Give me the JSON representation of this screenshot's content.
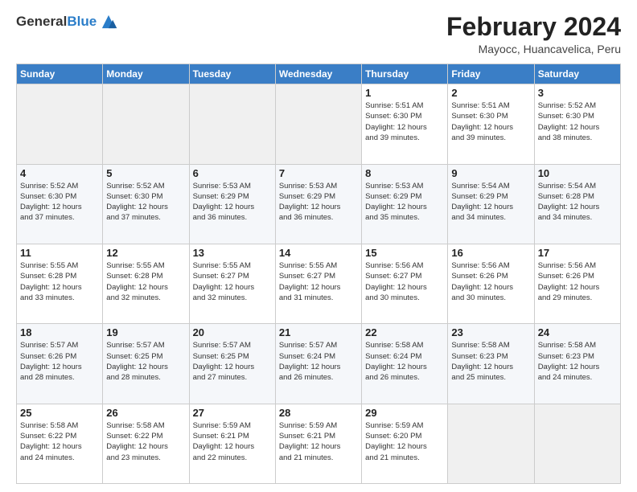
{
  "logo": {
    "general": "General",
    "blue": "Blue"
  },
  "title": "February 2024",
  "location": "Mayocc, Huancavelica, Peru",
  "days_header": [
    "Sunday",
    "Monday",
    "Tuesday",
    "Wednesday",
    "Thursday",
    "Friday",
    "Saturday"
  ],
  "weeks": [
    [
      {
        "day": "",
        "info": ""
      },
      {
        "day": "",
        "info": ""
      },
      {
        "day": "",
        "info": ""
      },
      {
        "day": "",
        "info": ""
      },
      {
        "day": "1",
        "info": "Sunrise: 5:51 AM\nSunset: 6:30 PM\nDaylight: 12 hours\nand 39 minutes."
      },
      {
        "day": "2",
        "info": "Sunrise: 5:51 AM\nSunset: 6:30 PM\nDaylight: 12 hours\nand 39 minutes."
      },
      {
        "day": "3",
        "info": "Sunrise: 5:52 AM\nSunset: 6:30 PM\nDaylight: 12 hours\nand 38 minutes."
      }
    ],
    [
      {
        "day": "4",
        "info": "Sunrise: 5:52 AM\nSunset: 6:30 PM\nDaylight: 12 hours\nand 37 minutes."
      },
      {
        "day": "5",
        "info": "Sunrise: 5:52 AM\nSunset: 6:30 PM\nDaylight: 12 hours\nand 37 minutes."
      },
      {
        "day": "6",
        "info": "Sunrise: 5:53 AM\nSunset: 6:29 PM\nDaylight: 12 hours\nand 36 minutes."
      },
      {
        "day": "7",
        "info": "Sunrise: 5:53 AM\nSunset: 6:29 PM\nDaylight: 12 hours\nand 36 minutes."
      },
      {
        "day": "8",
        "info": "Sunrise: 5:53 AM\nSunset: 6:29 PM\nDaylight: 12 hours\nand 35 minutes."
      },
      {
        "day": "9",
        "info": "Sunrise: 5:54 AM\nSunset: 6:29 PM\nDaylight: 12 hours\nand 34 minutes."
      },
      {
        "day": "10",
        "info": "Sunrise: 5:54 AM\nSunset: 6:28 PM\nDaylight: 12 hours\nand 34 minutes."
      }
    ],
    [
      {
        "day": "11",
        "info": "Sunrise: 5:55 AM\nSunset: 6:28 PM\nDaylight: 12 hours\nand 33 minutes."
      },
      {
        "day": "12",
        "info": "Sunrise: 5:55 AM\nSunset: 6:28 PM\nDaylight: 12 hours\nand 32 minutes."
      },
      {
        "day": "13",
        "info": "Sunrise: 5:55 AM\nSunset: 6:27 PM\nDaylight: 12 hours\nand 32 minutes."
      },
      {
        "day": "14",
        "info": "Sunrise: 5:55 AM\nSunset: 6:27 PM\nDaylight: 12 hours\nand 31 minutes."
      },
      {
        "day": "15",
        "info": "Sunrise: 5:56 AM\nSunset: 6:27 PM\nDaylight: 12 hours\nand 30 minutes."
      },
      {
        "day": "16",
        "info": "Sunrise: 5:56 AM\nSunset: 6:26 PM\nDaylight: 12 hours\nand 30 minutes."
      },
      {
        "day": "17",
        "info": "Sunrise: 5:56 AM\nSunset: 6:26 PM\nDaylight: 12 hours\nand 29 minutes."
      }
    ],
    [
      {
        "day": "18",
        "info": "Sunrise: 5:57 AM\nSunset: 6:26 PM\nDaylight: 12 hours\nand 28 minutes."
      },
      {
        "day": "19",
        "info": "Sunrise: 5:57 AM\nSunset: 6:25 PM\nDaylight: 12 hours\nand 28 minutes."
      },
      {
        "day": "20",
        "info": "Sunrise: 5:57 AM\nSunset: 6:25 PM\nDaylight: 12 hours\nand 27 minutes."
      },
      {
        "day": "21",
        "info": "Sunrise: 5:57 AM\nSunset: 6:24 PM\nDaylight: 12 hours\nand 26 minutes."
      },
      {
        "day": "22",
        "info": "Sunrise: 5:58 AM\nSunset: 6:24 PM\nDaylight: 12 hours\nand 26 minutes."
      },
      {
        "day": "23",
        "info": "Sunrise: 5:58 AM\nSunset: 6:23 PM\nDaylight: 12 hours\nand 25 minutes."
      },
      {
        "day": "24",
        "info": "Sunrise: 5:58 AM\nSunset: 6:23 PM\nDaylight: 12 hours\nand 24 minutes."
      }
    ],
    [
      {
        "day": "25",
        "info": "Sunrise: 5:58 AM\nSunset: 6:22 PM\nDaylight: 12 hours\nand 24 minutes."
      },
      {
        "day": "26",
        "info": "Sunrise: 5:58 AM\nSunset: 6:22 PM\nDaylight: 12 hours\nand 23 minutes."
      },
      {
        "day": "27",
        "info": "Sunrise: 5:59 AM\nSunset: 6:21 PM\nDaylight: 12 hours\nand 22 minutes."
      },
      {
        "day": "28",
        "info": "Sunrise: 5:59 AM\nSunset: 6:21 PM\nDaylight: 12 hours\nand 21 minutes."
      },
      {
        "day": "29",
        "info": "Sunrise: 5:59 AM\nSunset: 6:20 PM\nDaylight: 12 hours\nand 21 minutes."
      },
      {
        "day": "",
        "info": ""
      },
      {
        "day": "",
        "info": ""
      }
    ]
  ]
}
